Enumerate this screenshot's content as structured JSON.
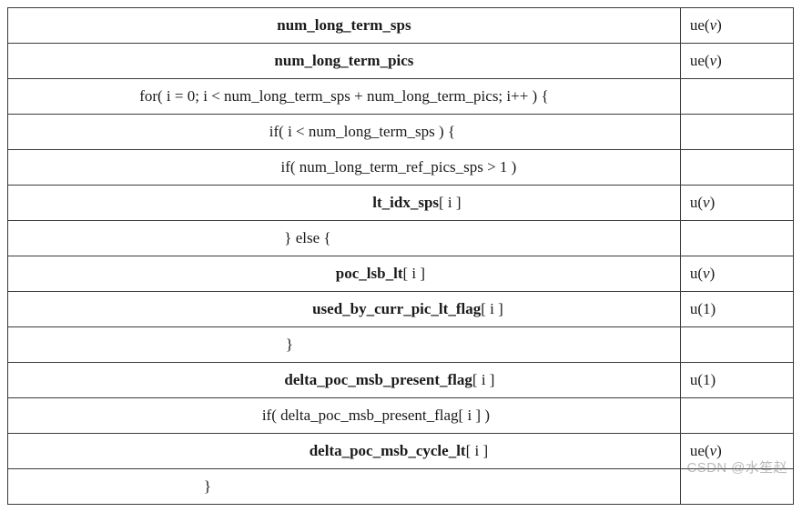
{
  "rows": [
    {
      "indentPx": 0,
      "segments": [
        "num_long_term_sps"
      ],
      "boldSeg": [
        true
      ],
      "descriptor": "ue(",
      "descriptorItalic": "v",
      "descriptorTail": ")"
    },
    {
      "indentPx": 0,
      "segments": [
        "num_long_term_pics"
      ],
      "boldSeg": [
        true
      ],
      "descriptor": "ue(",
      "descriptorItalic": "v",
      "descriptorTail": ")"
    },
    {
      "indentPx": 0,
      "segments": [
        "for( i = 0; i < num_long_term_sps + num_long_term_pics; i++ ) {"
      ],
      "boldSeg": [
        false
      ],
      "descriptor": "",
      "descriptorItalic": "",
      "descriptorTail": ""
    },
    {
      "indentPx": 20,
      "segments": [
        "if( i < num_long_term_sps ) {"
      ],
      "boldSeg": [
        false
      ],
      "descriptor": "",
      "descriptorItalic": "",
      "descriptorTail": ""
    },
    {
      "indentPx": 60,
      "segments": [
        "if( num_long_term_ref_pics_sps > 1 )"
      ],
      "boldSeg": [
        false
      ],
      "descriptor": "",
      "descriptorItalic": "",
      "descriptorTail": ""
    },
    {
      "indentPx": 80,
      "segments": [
        "lt_idx_sps",
        "[ i ]"
      ],
      "boldSeg": [
        true,
        false
      ],
      "descriptor": "u(",
      "descriptorItalic": "v",
      "descriptorTail": ")"
    },
    {
      "indentPx": -40,
      "segments": [
        "} else {"
      ],
      "boldSeg": [
        false
      ],
      "descriptor": "",
      "descriptorItalic": "",
      "descriptorTail": ""
    },
    {
      "indentPx": 40,
      "segments": [
        "poc_lsb_lt",
        "[ i ]"
      ],
      "boldSeg": [
        true,
        false
      ],
      "descriptor": "u(",
      "descriptorItalic": "v",
      "descriptorTail": ")"
    },
    {
      "indentPx": 70,
      "segments": [
        "used_by_curr_pic_lt_flag",
        "[ i ]"
      ],
      "boldSeg": [
        true,
        false
      ],
      "descriptor": "u(1)",
      "descriptorItalic": "",
      "descriptorTail": ""
    },
    {
      "indentPx": -60,
      "segments": [
        "}"
      ],
      "boldSeg": [
        false
      ],
      "descriptor": "",
      "descriptorItalic": "",
      "descriptorTail": ""
    },
    {
      "indentPx": 50,
      "segments": [
        "delta_poc_msb_present_flag",
        "[ i ]"
      ],
      "boldSeg": [
        true,
        false
      ],
      "descriptor": "u(1)",
      "descriptorItalic": "",
      "descriptorTail": ""
    },
    {
      "indentPx": 35,
      "segments": [
        "if( delta_poc_msb_present_flag[ i ] )"
      ],
      "boldSeg": [
        false
      ],
      "descriptor": "",
      "descriptorItalic": "",
      "descriptorTail": ""
    },
    {
      "indentPx": 60,
      "segments": [
        "delta_poc_msb_cycle_lt",
        "[ i ]"
      ],
      "boldSeg": [
        true,
        false
      ],
      "descriptor": "ue(",
      "descriptorItalic": "v",
      "descriptorTail": ")"
    },
    {
      "indentPx": -150,
      "segments": [
        "}"
      ],
      "boldSeg": [
        false
      ],
      "descriptor": "",
      "descriptorItalic": "",
      "descriptorTail": ""
    }
  ],
  "watermark": "CSDN @水笙赵"
}
